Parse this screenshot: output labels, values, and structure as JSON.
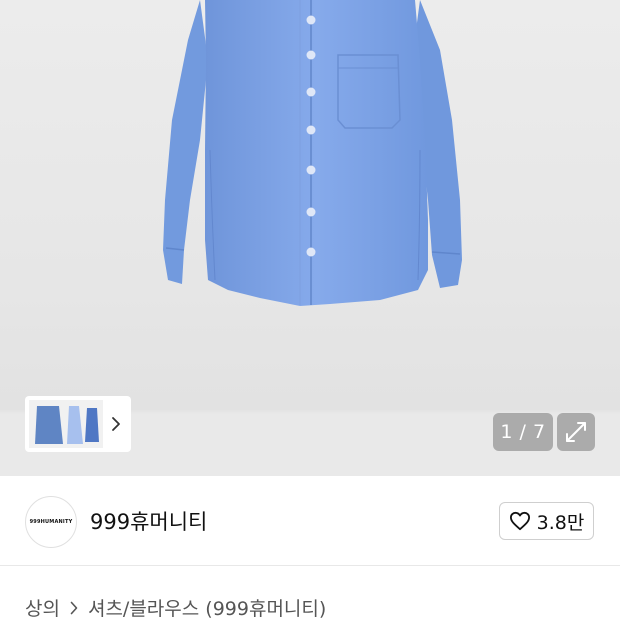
{
  "gallery": {
    "counter": "1 / 7",
    "colors": {
      "background": "#e6e6e6",
      "shirt": "#7ea3e6",
      "counter_bg": "#969696"
    }
  },
  "brand": {
    "logo_text": "999HUMANITY",
    "name": "999휴머니티",
    "likes": "3.8만"
  },
  "breadcrumb": {
    "items": [
      "상의",
      "셔츠/블라우스 (999휴머니티)"
    ]
  },
  "icons": {
    "thumb_next": "chevron-right-icon",
    "expand": "expand-icon",
    "like": "heart-icon",
    "separator": "chevron-right-icon"
  }
}
